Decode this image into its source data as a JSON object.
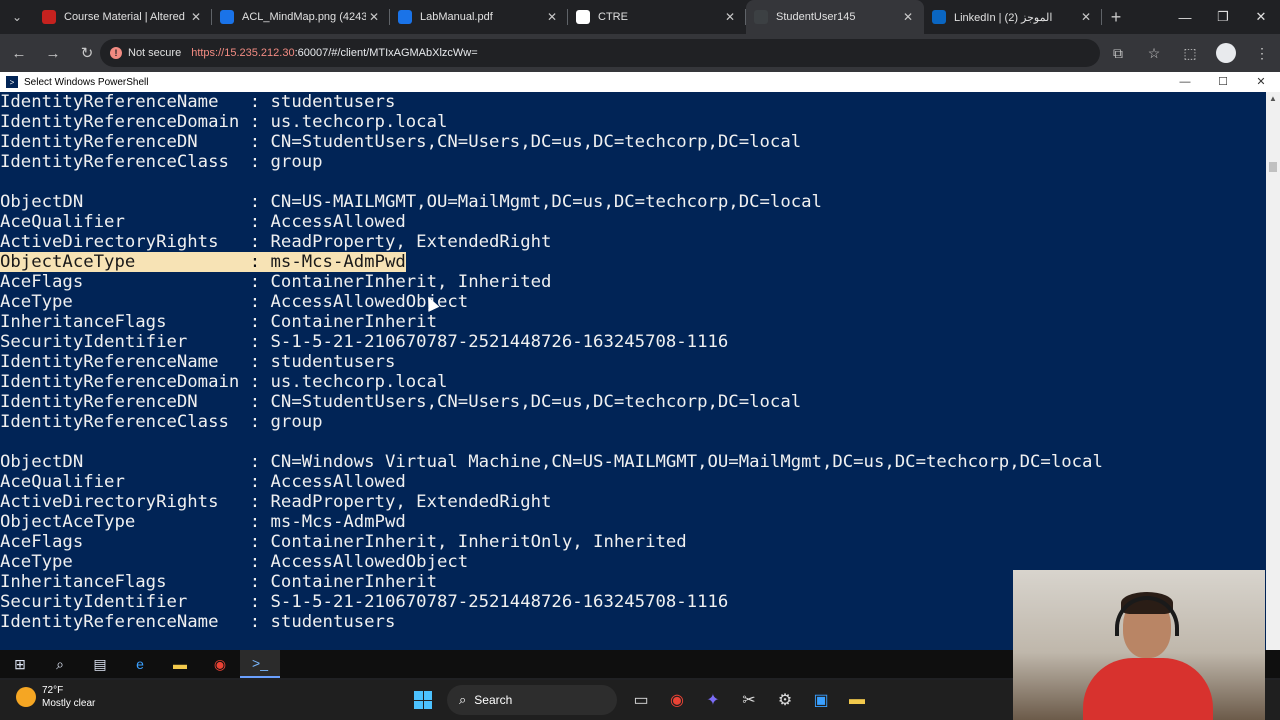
{
  "browser": {
    "tabs": [
      {
        "label": "Course Material | Altered S",
        "favicon_color": "#c5221f",
        "active": false
      },
      {
        "label": "ACL_MindMap.png (4243×",
        "favicon_color": "#1a73e8",
        "active": false
      },
      {
        "label": "LabManual.pdf",
        "favicon_color": "#1a73e8",
        "active": false
      },
      {
        "label": "CTRE",
        "favicon_color": "#ffffff",
        "active": false
      },
      {
        "label": "StudentUser145",
        "favicon_color": "#3c4043",
        "active": true
      },
      {
        "label": "LinkedIn | (2) الموجز",
        "favicon_color": "#0a66c2",
        "active": false
      }
    ],
    "security_label": "Not secure",
    "url_host": "https://15.235.212.30",
    "url_rest": ":60007/#/client/MTIxAGMAbXlzcWw="
  },
  "window": {
    "title": "Select Windows PowerShell"
  },
  "console_lines": [
    {
      "key": "IdentityReferenceName",
      "value": "studentusers"
    },
    {
      "key": "IdentityReferenceDomain",
      "value": "us.techcorp.local"
    },
    {
      "key": "IdentityReferenceDN",
      "value": "CN=StudentUsers,CN=Users,DC=us,DC=techcorp,DC=local"
    },
    {
      "key": "IdentityReferenceClass",
      "value": "group"
    },
    {
      "key": "",
      "value": ""
    },
    {
      "key": "ObjectDN",
      "value": "CN=US-MAILMGMT,OU=MailMgmt,DC=us,DC=techcorp,DC=local"
    },
    {
      "key": "AceQualifier",
      "value": "AccessAllowed"
    },
    {
      "key": "ActiveDirectoryRights",
      "value": "ReadProperty, ExtendedRight"
    },
    {
      "key": "ObjectAceType",
      "value": "ms-Mcs-AdmPwd",
      "highlight": true
    },
    {
      "key": "AceFlags",
      "value": "ContainerInherit, Inherited"
    },
    {
      "key": "AceType",
      "value": "AccessAllowedObject"
    },
    {
      "key": "InheritanceFlags",
      "value": "ContainerInherit"
    },
    {
      "key": "SecurityIdentifier",
      "value": "S-1-5-21-210670787-2521448726-163245708-1116"
    },
    {
      "key": "IdentityReferenceName",
      "value": "studentusers"
    },
    {
      "key": "IdentityReferenceDomain",
      "value": "us.techcorp.local"
    },
    {
      "key": "IdentityReferenceDN",
      "value": "CN=StudentUsers,CN=Users,DC=us,DC=techcorp,DC=local"
    },
    {
      "key": "IdentityReferenceClass",
      "value": "group"
    },
    {
      "key": "",
      "value": ""
    },
    {
      "key": "ObjectDN",
      "value": "CN=Windows Virtual Machine,CN=US-MAILMGMT,OU=MailMgmt,DC=us,DC=techcorp,DC=local"
    },
    {
      "key": "AceQualifier",
      "value": "AccessAllowed"
    },
    {
      "key": "ActiveDirectoryRights",
      "value": "ReadProperty, ExtendedRight"
    },
    {
      "key": "ObjectAceType",
      "value": "ms-Mcs-AdmPwd"
    },
    {
      "key": "AceFlags",
      "value": "ContainerInherit, InheritOnly, Inherited"
    },
    {
      "key": "AceType",
      "value": "AccessAllowedObject"
    },
    {
      "key": "InheritanceFlags",
      "value": "ContainerInherit"
    },
    {
      "key": "SecurityIdentifier",
      "value": "S-1-5-21-210670787-2521448726-163245708-1116"
    },
    {
      "key": "IdentityReferenceName",
      "value": "studentusers"
    }
  ],
  "taskbar": {
    "temperature": "72°F",
    "weather": "Mostly clear",
    "search_label": "Search"
  },
  "colors": {
    "console_bg": "#012456",
    "highlight": "#f7e3b5"
  }
}
